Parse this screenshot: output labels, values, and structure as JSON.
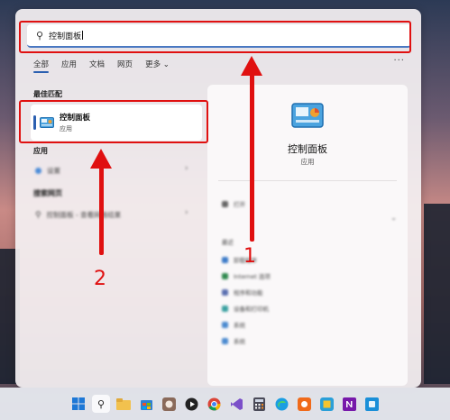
{
  "search": {
    "query": "控制面板"
  },
  "tabs": [
    {
      "label": "全部",
      "active": true
    },
    {
      "label": "应用"
    },
    {
      "label": "文档"
    },
    {
      "label": "网页"
    },
    {
      "label": "更多 ⌄"
    }
  ],
  "more_dots": "···",
  "sections": {
    "best_match": "最佳匹配",
    "apps": "应用",
    "web": "搜索网页"
  },
  "best_match": {
    "name": "控制面板",
    "type": "应用"
  },
  "app_result": {
    "label": "设置"
  },
  "web_result": {
    "label": "控制面板 - 查看网络结果"
  },
  "detail": {
    "title": "控制面板",
    "type": "应用",
    "open_label": "打开",
    "recent_label": "最近",
    "recent": [
      "卸载程序",
      "Internet 选项",
      "程序和功能",
      "设备和打印机",
      "系统",
      "系统"
    ]
  },
  "annotations": {
    "one": "1",
    "two": "2"
  },
  "colors": {
    "accent": "#2b5fb0",
    "annotation": "#e01010"
  },
  "taskbar_icons": [
    "windows-icon",
    "search-icon",
    "file-explorer-icon",
    "store-icon",
    "media-icon",
    "player-icon",
    "chrome-icon",
    "vs-icon",
    "calculator-icon",
    "edge-icon",
    "app-icon",
    "app2-icon",
    "onenote-icon",
    "app3-icon"
  ]
}
